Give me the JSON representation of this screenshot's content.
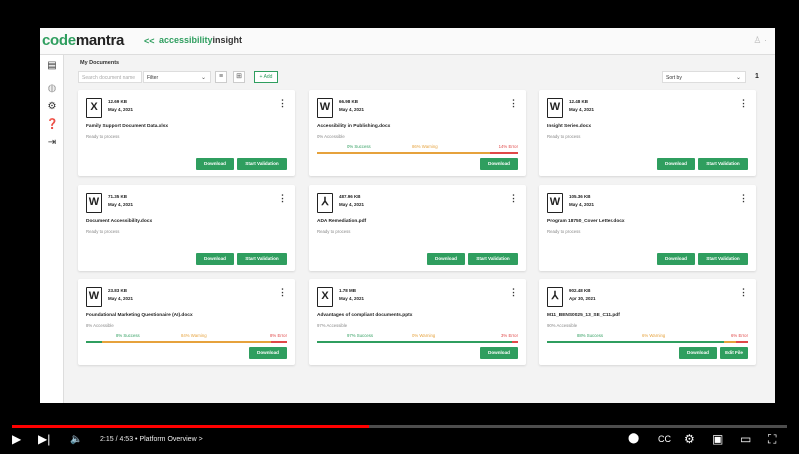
{
  "header": {
    "logo_part1": "code",
    "logo_part2": "mantra",
    "back": "<<",
    "product_part1": "accessibility",
    "product_part2": "insight",
    "user": "♙ ·"
  },
  "toolbar": {
    "title": "My Documents",
    "search_placeholder": "Search document name",
    "filter": "Filter",
    "add": "+ Add",
    "sort": "Sort by",
    "page": "1"
  },
  "cards": [
    {
      "size": "12.69 KB",
      "date": "May 4, 2021",
      "name": "Family Support Document Data.xlsx",
      "status": "Ready to process",
      "type": "X",
      "buttons": [
        "Download",
        "Start Validation"
      ]
    },
    {
      "size": "66.98 KB",
      "date": "May 4, 2021",
      "name": "Accessibility in Publishing.docx",
      "status": "0% Accessible",
      "type": "W",
      "success": "0% Success",
      "warning": "86% Warning",
      "error": "14% Error",
      "buttons": [
        "Download"
      ]
    },
    {
      "size": "12.48 KB",
      "date": "May 4, 2021",
      "name": "Insight Series.docx",
      "status": "Ready to process",
      "type": "W",
      "buttons": [
        "Download",
        "Start Validation"
      ]
    },
    {
      "size": "71.35 KB",
      "date": "May 4, 2021",
      "name": "Document Accessibility.docx",
      "status": "Ready to process",
      "type": "W",
      "buttons": [
        "Download",
        "Start Validation"
      ]
    },
    {
      "size": "487.96 KB",
      "date": "May 4, 2021",
      "name": "ADA Remediation.pdf",
      "status": "Ready to process",
      "type": "P",
      "buttons": [
        "Download",
        "Start Validation"
      ]
    },
    {
      "size": "105.36 KB",
      "date": "May 4, 2021",
      "name": "Program 18750_Cover Letter.docx",
      "status": "Ready to process",
      "type": "W",
      "buttons": [
        "Download",
        "Start Validation"
      ]
    },
    {
      "size": "23.83 KB",
      "date": "May 4, 2021",
      "name": "Foundational Marketing Questionaire (AI).docx",
      "status": "8% Accessible",
      "type": "W",
      "success": "8% Success",
      "warning": "84% Warning",
      "error": "8% Error",
      "buttons": [
        "Download"
      ]
    },
    {
      "size": "1.78 MB",
      "date": "May 4, 2021",
      "name": "Advantages of compliant documents.pptx",
      "status": "97% Accessible",
      "type": "X",
      "success": "97% Success",
      "warning": "0% Warning",
      "error": "3% Error",
      "buttons": [
        "Download"
      ]
    },
    {
      "size": "902.48 KB",
      "date": "Apr 30, 2021",
      "name": "M11_BENS0025_13_SE_C11.pdf",
      "status": "90% Accessible",
      "type": "P",
      "success": "88% Success",
      "warning": "6% Warning",
      "error": "6% Error",
      "buttons": [
        "Download",
        "Edit File"
      ]
    }
  ],
  "bars": [
    null,
    {
      "s": 0,
      "w": 86,
      "e": 14
    },
    null,
    null,
    null,
    null,
    {
      "s": 8,
      "w": 84,
      "e": 8
    },
    {
      "s": 97,
      "w": 0,
      "e": 3
    },
    {
      "s": 88,
      "w": 6,
      "e": 6
    }
  ],
  "player": {
    "time": "2:15 / 4:53",
    "chapter": "• Platform Overview >",
    "progress": 0.46
  }
}
